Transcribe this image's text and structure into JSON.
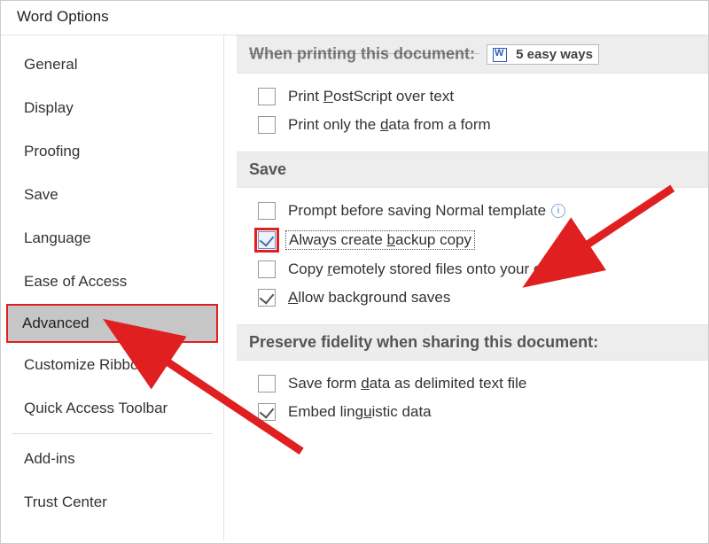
{
  "window": {
    "title": "Word Options"
  },
  "sidebar": {
    "items": [
      {
        "label": "General",
        "selected": false
      },
      {
        "label": "Display",
        "selected": false
      },
      {
        "label": "Proofing",
        "selected": false
      },
      {
        "label": "Save",
        "selected": false
      },
      {
        "label": "Language",
        "selected": false
      },
      {
        "label": "Ease of Access",
        "selected": false
      },
      {
        "label": "Advanced",
        "selected": true
      },
      {
        "label": "Customize Ribbon",
        "selected": false
      },
      {
        "label": "Quick Access Toolbar",
        "selected": false
      },
      {
        "label": "Add-ins",
        "selected": false
      },
      {
        "label": "Trust Center",
        "selected": false
      }
    ],
    "dividers_after": [
      8
    ]
  },
  "content": {
    "section_print": {
      "heading": "When printing this document:",
      "dropdown_text": "5 easy ways",
      "options": [
        {
          "label_html": "Print <span class='ul'>P</span>ostScript over text",
          "checked": false
        },
        {
          "label_html": "Print only the <span class='ul'>d</span>ata from a form",
          "checked": false
        }
      ]
    },
    "section_save": {
      "heading": "Save",
      "options": [
        {
          "label_html": "Prompt before saving Normal template",
          "checked": false,
          "info": true
        },
        {
          "label_html": "Always create <span class='ul'>b</span>ackup copy",
          "checked": true,
          "focus": true,
          "highlight": true
        },
        {
          "label_html": "Copy <span class='ul'>r</span>emotely stored files onto your compute",
          "checked": false
        },
        {
          "label_html": "<span class='ul'>A</span>llow background saves",
          "checked": true
        }
      ]
    },
    "section_preserve": {
      "heading": "Preserve fidelity when sharing this document:",
      "options": [
        {
          "label_html": "Save form <span class='ul'>d</span>ata as delimited text file",
          "checked": false
        },
        {
          "label_html": "Embed ling<span class='ul'>u</span>istic data",
          "checked": true
        }
      ]
    }
  },
  "annotations": {
    "arrow_color": "#e02020"
  }
}
